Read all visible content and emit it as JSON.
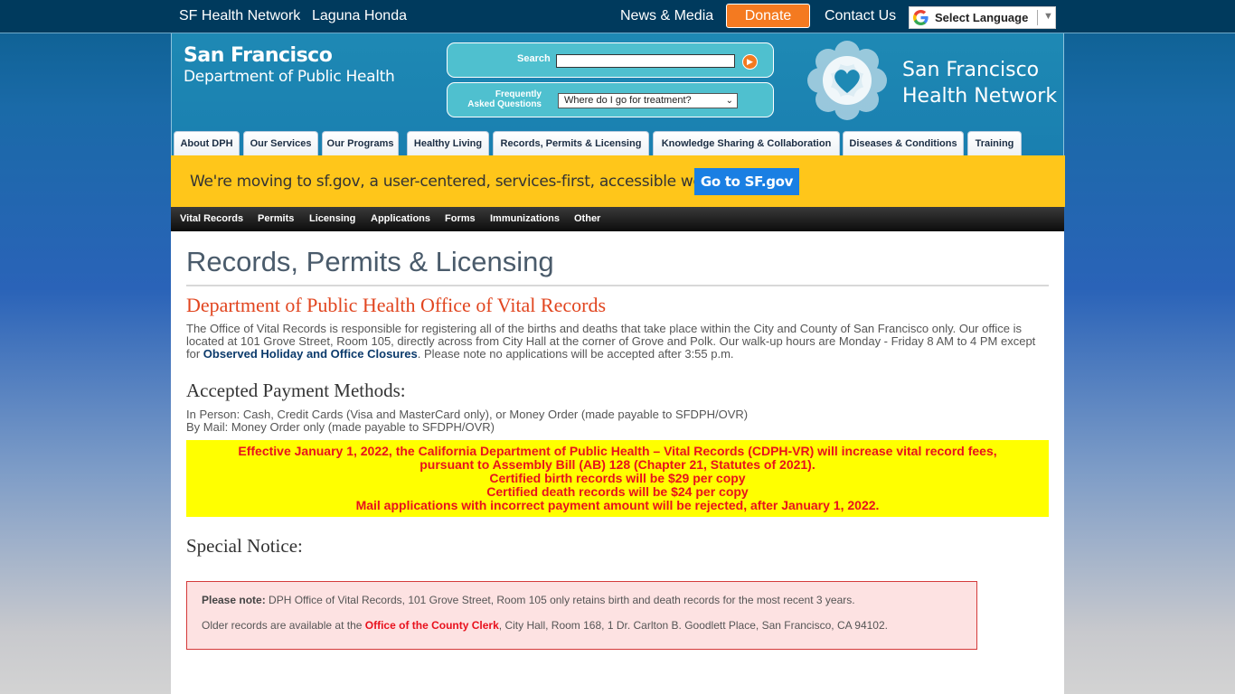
{
  "topbar": {
    "link_sfhn": "SF Health Network",
    "link_laguna": "Laguna Honda",
    "link_news": "News & Media",
    "donate": "Donate",
    "contact": "Contact Us",
    "language": "Select Language"
  },
  "header": {
    "logo_line1": "San Francisco",
    "logo_line2": "Department of Public Health",
    "search_label": "Search",
    "search_value": "",
    "faq_label_line1": "Frequently",
    "faq_label_line2": "Asked Questions",
    "faq_selected": "Where do I go for treatment?",
    "sfhn_line1": "San Francisco",
    "sfhn_line2": "Health Network"
  },
  "tabs": [
    "About DPH",
    "Our Services",
    "Our Programs",
    "Healthy Living",
    "Records, Permits & Licensing",
    "Knowledge Sharing & Collaboration",
    "Diseases & Conditions",
    "Training"
  ],
  "banner": {
    "message": "We're moving to sf.gov, a user-centered, services-first, accessible website.",
    "button": "Go to SF.gov"
  },
  "subnav": [
    "Vital Records",
    "Permits",
    "Licensing",
    "Applications",
    "Forms",
    "Immunizations",
    "Other"
  ],
  "content": {
    "page_title": "Records, Permits & Licensing",
    "section_title": "Department of Public Health Office of Vital Records",
    "para_text1": "The Office of Vital Records is responsible for registering all of the births and deaths that take place within the City and County of San Francisco only. Our office is located at 101 Grove Street, Room 105, directly across from City Hall at the corner of Grove and Polk. Our walk-up hours are Monday - Friday 8 AM to 4 PM except for ",
    "para_link": "Observed Holiday and Office Closures",
    "para_text2": ". Please note no applications will be accepted after 3:55 p.m.",
    "payment_heading": "Accepted Payment Methods:",
    "payment_in_person": "In Person: Cash, Credit Cards (Visa and MasterCard only), or Money Order (made payable to SFDPH/OVR)",
    "payment_mail": "By Mail: Money Order only (made payable to SFDPH/OVR)",
    "fee_notice": [
      "Effective January 1, 2022, the California Department of Public Health – Vital Records (CDPH-VR) will increase vital record fees,",
      "pursuant to Assembly Bill (AB) 128 (Chapter 21, Statutes of 2021).",
      "Certified birth records will be $29 per copy",
      "Certified death records will be $24 per copy",
      "Mail applications with incorrect payment amount will be rejected, after January 1, 2022."
    ],
    "special_heading": "Special Notice:",
    "note_label": "Please note:",
    "note_text": " DPH Office of Vital Records, 101 Grove Street, Room 105 only retains birth and death records for the most recent 3 years.",
    "older_text1": "Older records are available at the ",
    "older_link": "Office of the County Clerk",
    "older_text2": ", City Hall, Room 168, 1 Dr. Carlton B. Goodlett Place, San Francisco, CA 94102."
  },
  "colors": {
    "donate": "#f47a20",
    "banner": "#ffc61a",
    "banner_button": "#1a7fe3",
    "notice_yellow": "#ffff00",
    "notice_red": "#e8111d"
  }
}
